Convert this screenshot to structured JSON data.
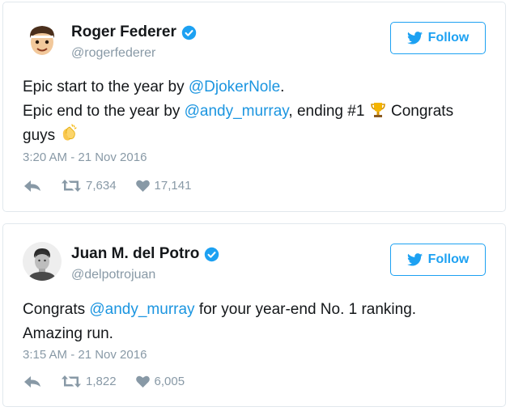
{
  "colors": {
    "accent": "#1da1f2",
    "link": "#1b95e0",
    "muted": "#8899a6",
    "text": "#14171a",
    "border": "#e1e8ed"
  },
  "tweets": [
    {
      "avatar_icon": "emoji-avatar-icon",
      "display_name": "Roger Federer",
      "username": "@rogerfederer",
      "follow_label": "Follow",
      "text": {
        "l1_pre": "Epic start to the year by ",
        "l1_mention": "@DjokerNole",
        "l1_post": ".",
        "l2_pre": "Epic end to the year by ",
        "l2_mention": "@andy_murray",
        "l2_post": ", ending #1 ",
        "l2_post2": " Congrats",
        "l3_pre": "guys "
      },
      "timestamp": "3:20 AM - 21 Nov 2016",
      "retweets": "7,634",
      "likes": "17,141"
    },
    {
      "avatar_icon": "photo-avatar-icon",
      "display_name": "Juan M. del Potro",
      "username": "@delpotrojuan",
      "follow_label": "Follow",
      "text": {
        "l1_pre": "Congrats ",
        "l1_mention": "@andy_murray",
        "l1_post": " for your year-end No. 1 ranking.",
        "l2": "Amazing run."
      },
      "timestamp": "3:15 AM - 21 Nov 2016",
      "retweets": "1,822",
      "likes": "6,005"
    }
  ]
}
